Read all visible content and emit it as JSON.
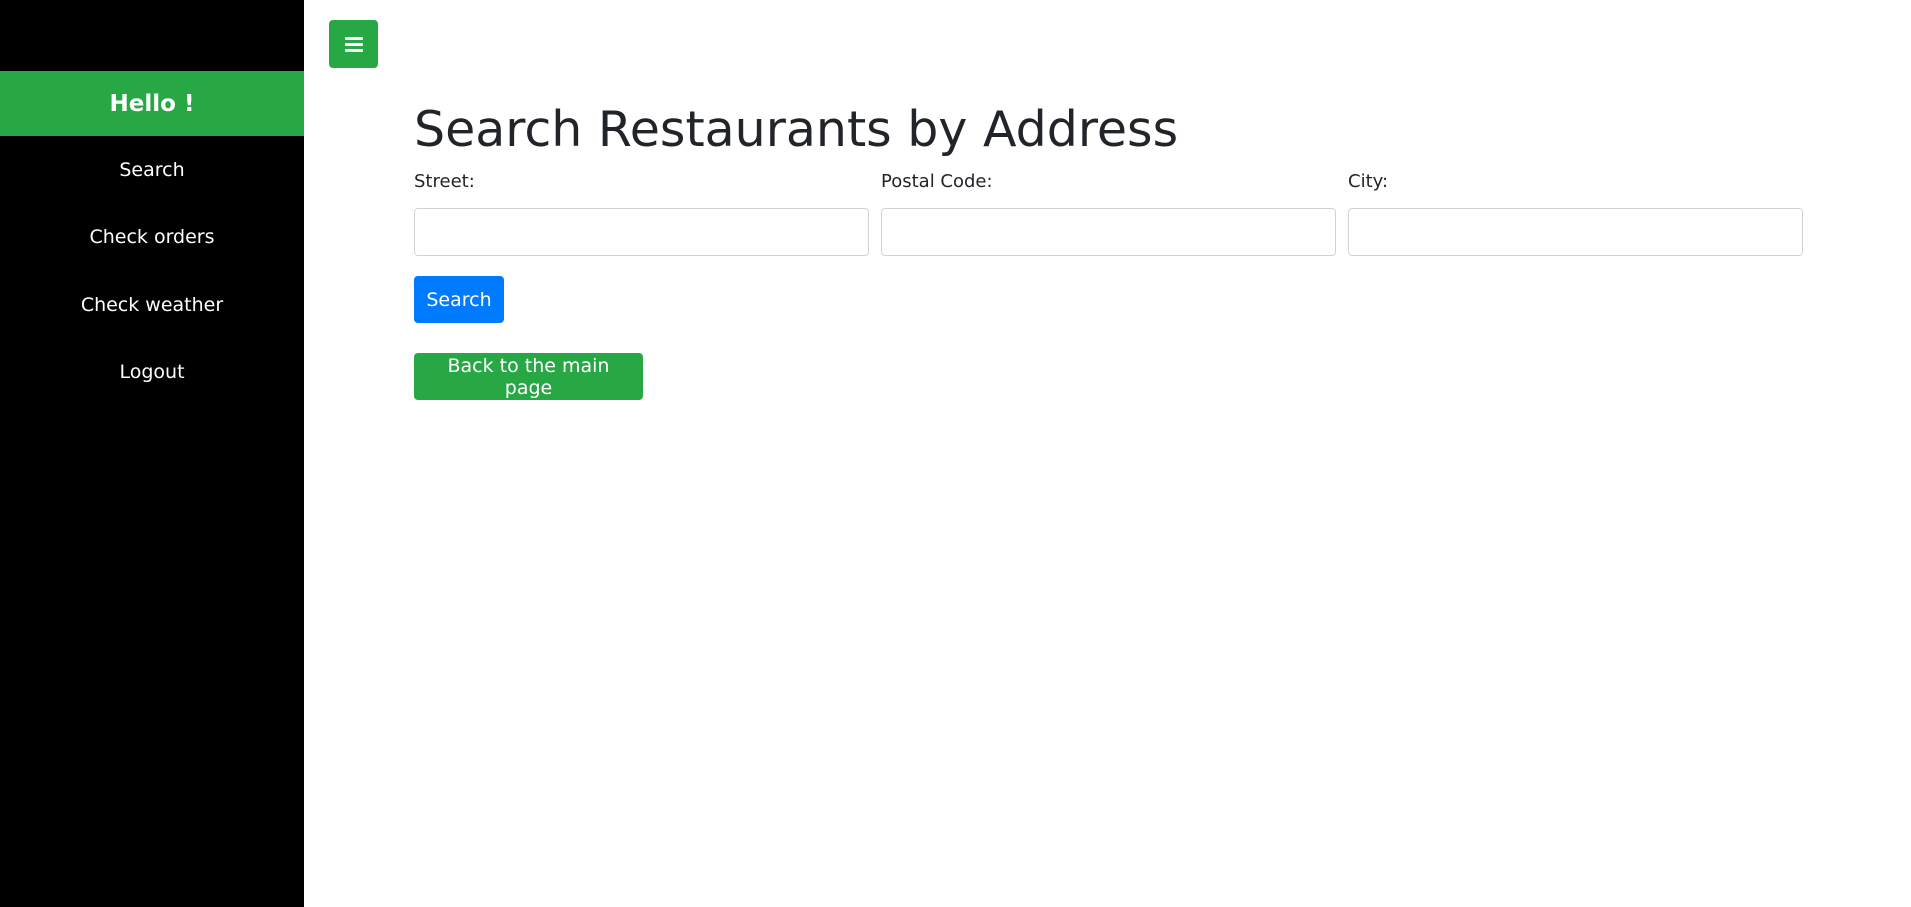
{
  "sidebar": {
    "greeting": "Hello !",
    "items": [
      {
        "label": "Search"
      },
      {
        "label": "Check orders"
      },
      {
        "label": "Check weather"
      },
      {
        "label": "Logout"
      }
    ]
  },
  "main": {
    "title": "Search Restaurants by Address",
    "fields": [
      {
        "label": "Street:",
        "value": "",
        "placeholder": ""
      },
      {
        "label": "Postal Code:",
        "value": "",
        "placeholder": ""
      },
      {
        "label": "City:",
        "value": "",
        "placeholder": ""
      }
    ],
    "search_label": "Search",
    "back_label": "Back to the main page"
  },
  "colors": {
    "sidebar_bg": "#000000",
    "accent_green": "#28a745",
    "primary_blue": "#007bff"
  },
  "icons": {
    "menu_toggle": "hamburger-menu-icon"
  }
}
